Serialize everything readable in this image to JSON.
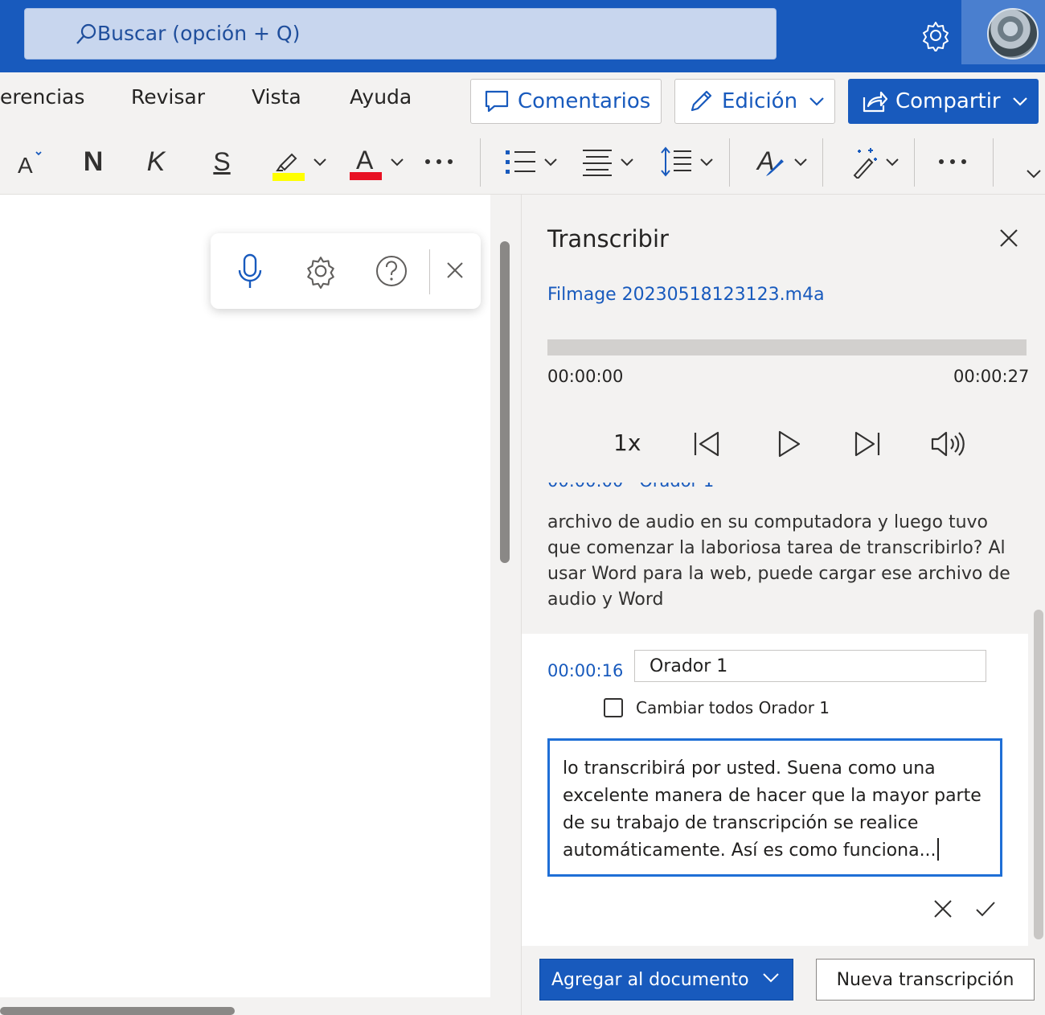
{
  "search": {
    "placeholder": "Buscar (opción + Q)"
  },
  "menu": {
    "items": [
      "erencias",
      "Revisar",
      "Vista",
      "Ayuda"
    ]
  },
  "buttons": {
    "comments": "Comentarios",
    "editing": "Edición",
    "share": "Compartir"
  },
  "toolbar": {
    "font_size_icon": "font-size-icon",
    "bold": "N",
    "italic": "K",
    "underline": "S",
    "font_color_letter": "A",
    "highlight_color": "#ffff00",
    "font_color": "#e81123"
  },
  "panel": {
    "title": "Transcribir",
    "filename": "Filmage 20230518123123.m4a",
    "time_start": "00:00:00",
    "time_end": "00:00:27",
    "speed": "1x",
    "prev_segment_text": "archivo de audio en su computadora y luego tuvo que comenzar la laboriosa tarea de transcribirlo? Al usar Word para la web, puede cargar ese archivo de audio y Word",
    "edit_segment": {
      "time": "00:00:16",
      "speaker": "Orador 1",
      "checkbox_label": "Cambiar todos Orador 1",
      "checked": false,
      "text": "lo transcribirá por usted. Suena como una excelente manera de hacer que la mayor parte de su trabajo de transcripción se realice automáticamente. Así es como funciona..."
    },
    "add_button": "Agregar al documento",
    "new_button": "Nueva transcripción"
  },
  "colors": {
    "brand": "#185abd",
    "accent": "#1f6fd6"
  }
}
